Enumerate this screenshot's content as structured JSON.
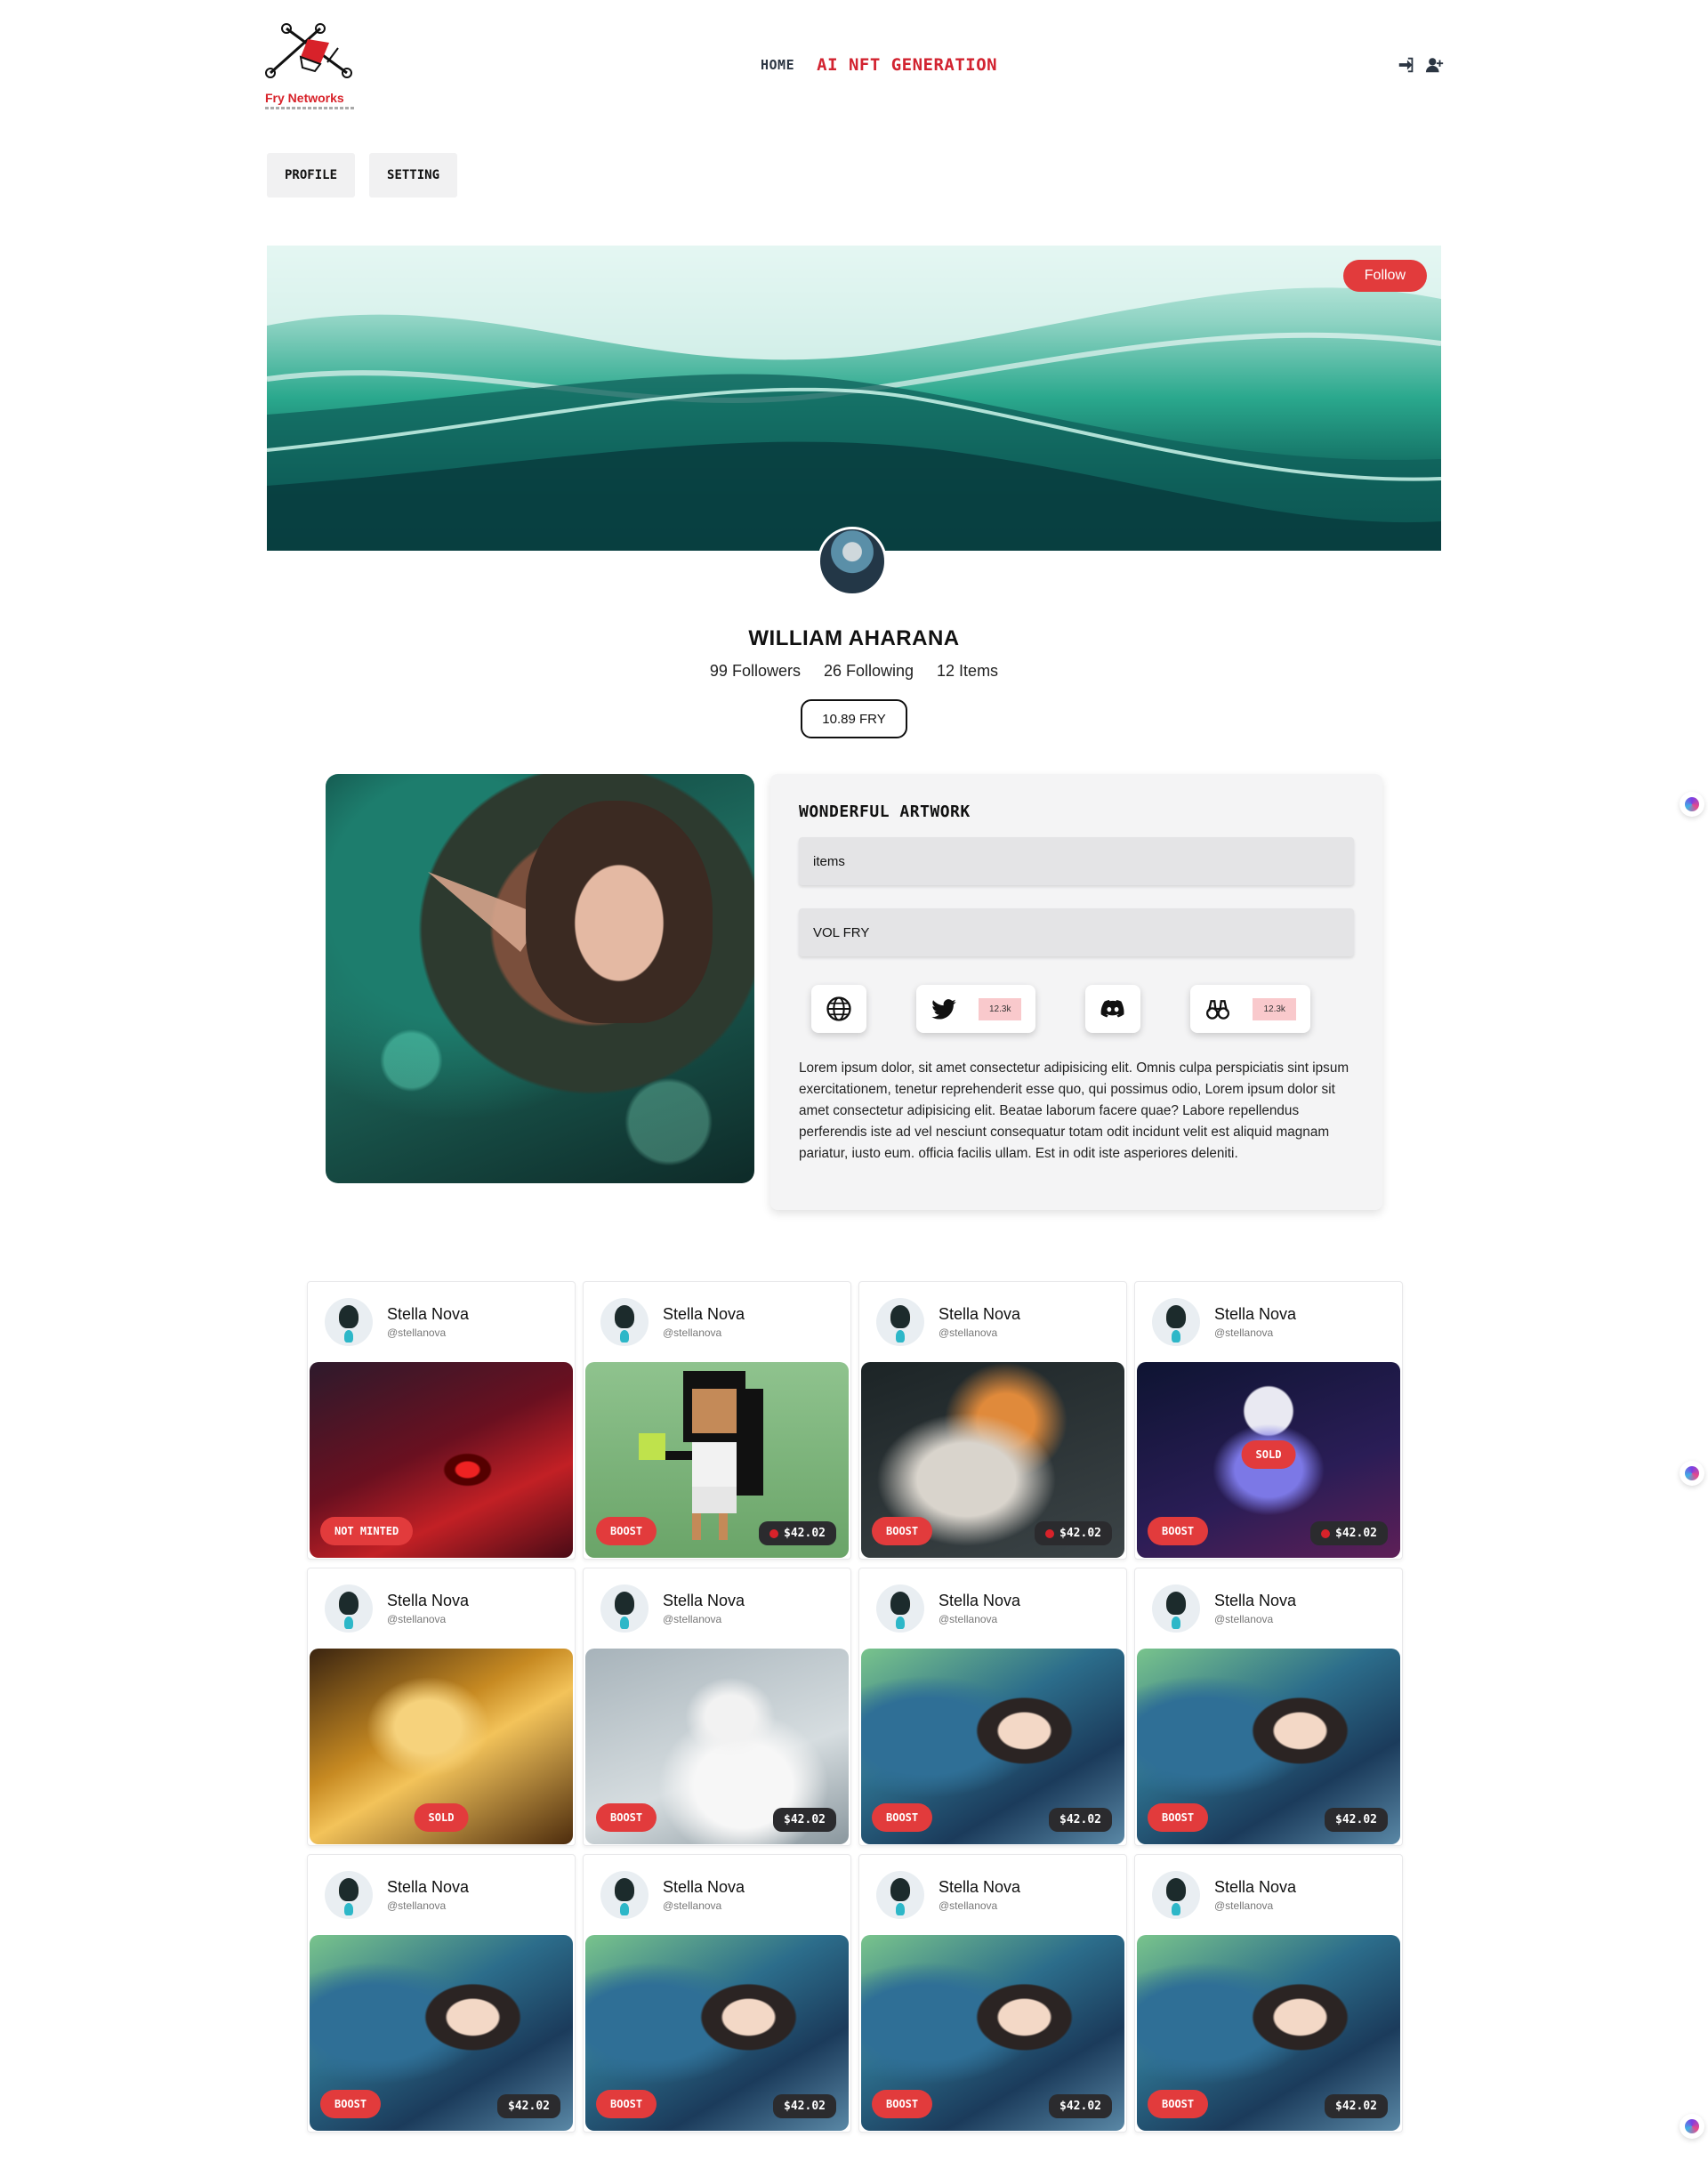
{
  "brand": {
    "name": "Fry Networks"
  },
  "nav": {
    "home": "HOME",
    "ai": "AI NFT GENERATION"
  },
  "header_icons": [
    "sign-in-icon",
    "user-plus-icon"
  ],
  "tabs": [
    "PROFILE",
    "SETTING"
  ],
  "banner": {
    "follow": "Follow"
  },
  "profile": {
    "name": "WILLIAM AHARANA",
    "followers": "99 Followers",
    "following": "26 Following",
    "items": "12 Items",
    "balance": "10.89 FRY"
  },
  "feature": {
    "title": "WONDERFUL ARTWORK",
    "field_items": "items",
    "field_vol": "VOL FRY",
    "twitter_count": "12.3k",
    "binoculars_count": "12.3k",
    "description": "Lorem ipsum dolor, sit amet consectetur adipisicing elit. Omnis culpa perspiciatis sint ipsum exercitationem, tenetur reprehenderit esse quo, qui possimus odio, Lorem ipsum dolor sit amet consectetur adipisicing elit. Beatae laborum facere quae? Labore repellendus perferendis iste ad vel nesciunt consequatur totam odit incidunt velit est aliquid magnam pariatur, iusto eum. officia facilis ullam. Est in odit iste asperiores deleniti."
  },
  "colors": {
    "accent": "#e23b3c",
    "brand_red": "#d22330",
    "nav_dark": "#2b3542"
  },
  "cards": [
    {
      "name": "Stella Nova",
      "handle": "@stellanova",
      "art": "anime-red",
      "badge": "NOT MINTED",
      "price": ""
    },
    {
      "name": "Stella Nova",
      "handle": "@stellanova",
      "art": "pixel",
      "badge": "BOOST",
      "price": "$42.02"
    },
    {
      "name": "Stella Nova",
      "handle": "@stellanova",
      "art": "coral",
      "badge": "BOOST",
      "price": "$42.02"
    },
    {
      "name": "Stella Nova",
      "handle": "@stellanova",
      "art": "space",
      "badge": "BOOST",
      "sold": "SOLD",
      "price": "$42.02"
    },
    {
      "name": "Stella Nova",
      "handle": "@stellanova",
      "art": "gold",
      "badge": "SOLD",
      "price": ""
    },
    {
      "name": "Stella Nova",
      "handle": "@stellanova",
      "art": "white",
      "badge": "BOOST",
      "price": "$42.02"
    },
    {
      "name": "Stella Nova",
      "handle": "@stellanova",
      "art": "dragon",
      "badge": "BOOST",
      "price": "$42.02"
    },
    {
      "name": "Stella Nova",
      "handle": "@stellanova",
      "art": "dragon",
      "badge": "BOOST",
      "price": "$42.02"
    },
    {
      "name": "Stella Nova",
      "handle": "@stellanova",
      "art": "dragon",
      "badge": "BOOST",
      "price": "$42.02"
    },
    {
      "name": "Stella Nova",
      "handle": "@stellanova",
      "art": "dragon",
      "badge": "BOOST",
      "price": "$42.02"
    },
    {
      "name": "Stella Nova",
      "handle": "@stellanova",
      "art": "dragon",
      "badge": "BOOST",
      "price": "$42.02"
    },
    {
      "name": "Stella Nova",
      "handle": "@stellanova",
      "art": "dragon",
      "badge": "BOOST",
      "price": "$42.02"
    }
  ]
}
